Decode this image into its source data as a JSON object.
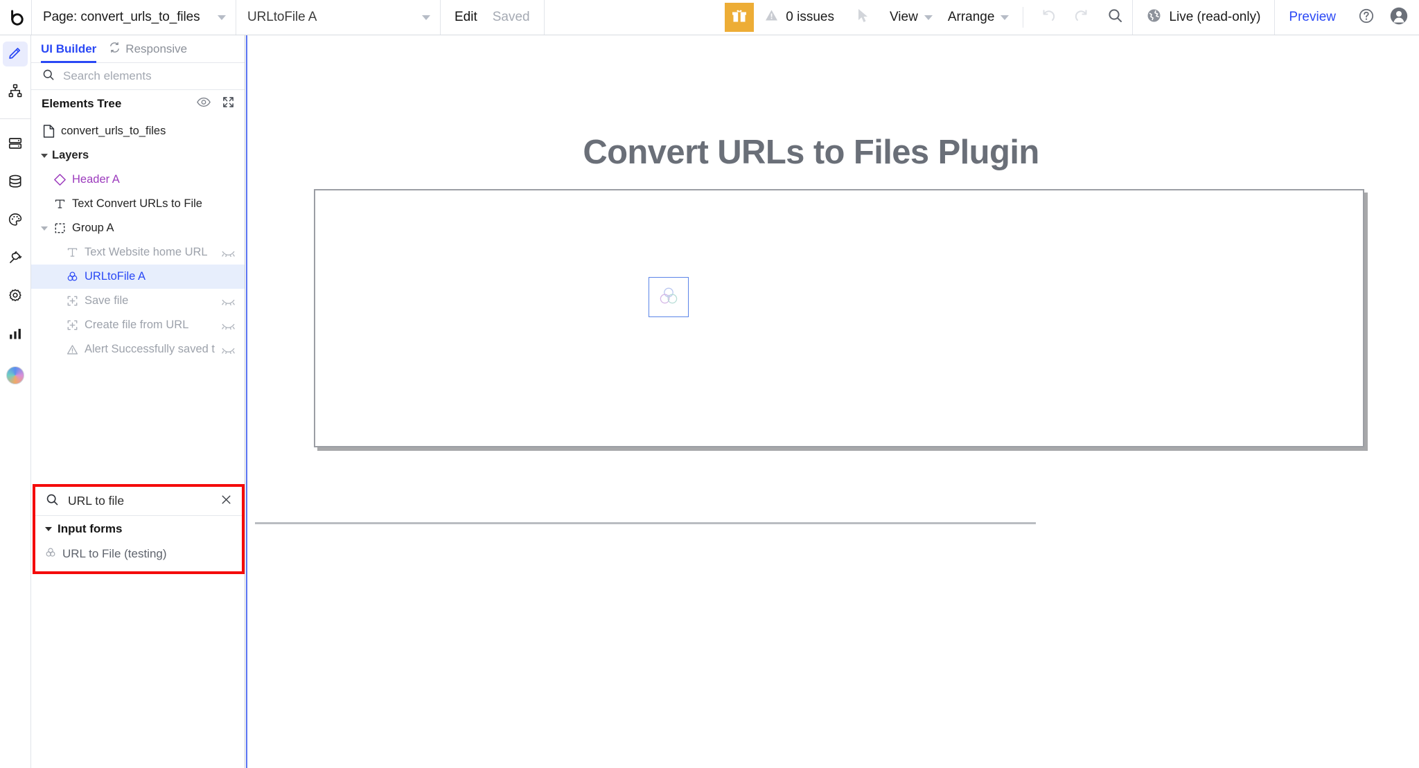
{
  "topbar": {
    "logo_icon": "bubble-logo-icon",
    "page_selector": {
      "label": "Page: convert_urls_to_files",
      "icon": "chevron-down-icon"
    },
    "element_selector": {
      "label": "URLtoFile A",
      "icon": "chevron-down-icon"
    },
    "edit_label": "Edit",
    "saved_label": "Saved",
    "gift_icon": "gift-icon",
    "issues": {
      "icon": "warning-triangle-icon",
      "label": "0 issues"
    },
    "cursor_icon": "cursor-arrow-icon",
    "view_menu": "View",
    "arrange_menu": "Arrange",
    "undo_icon": "undo-icon",
    "redo_icon": "redo-icon",
    "search_icon": "search-icon",
    "live": {
      "icon": "globe-icon",
      "label": "Live (read-only)"
    },
    "preview_label": "Preview",
    "help_icon": "question-circle-icon",
    "avatar_icon": "user-avatar-icon"
  },
  "rail": {
    "items": [
      {
        "name": "design",
        "icon": "pencil-icon",
        "active": true
      },
      {
        "name": "workflow",
        "icon": "sitemap-icon",
        "active": false
      },
      {
        "name": "data-sources",
        "icon": "server-icon",
        "active": false
      },
      {
        "name": "database",
        "icon": "database-icon",
        "active": false
      },
      {
        "name": "styles",
        "icon": "palette-icon",
        "active": false
      },
      {
        "name": "plugins",
        "icon": "plug-icon",
        "active": false
      },
      {
        "name": "settings",
        "icon": "gear-icon",
        "active": false
      },
      {
        "name": "logs",
        "icon": "bar-chart-icon",
        "active": false
      }
    ],
    "avatar_icon": "user-avatar-icon"
  },
  "panel": {
    "tabs": [
      {
        "label": "UI Builder",
        "active": true,
        "icon": ""
      },
      {
        "label": "Responsive",
        "active": false,
        "icon": "responsive-sync-icon"
      }
    ],
    "search": {
      "placeholder": "Search elements",
      "icon": "search-icon",
      "value": ""
    },
    "tree_header": {
      "title": "Elements Tree",
      "eye_icon": "eye-icon",
      "expand_icon": "expand-arrows-icon"
    },
    "tree": [
      {
        "label": "convert_urls_to_files",
        "icon": "page-file-icon",
        "indent": 0,
        "caret": "none",
        "color": "dark",
        "hidden": false,
        "selected": false
      },
      {
        "label": "Layers",
        "icon": "none",
        "indent": 1,
        "caret": "open",
        "color": "dark",
        "bold": true,
        "hidden": false,
        "selected": false
      },
      {
        "label": "Header A",
        "icon": "reusable-diamond-icon",
        "indent": 2,
        "caret": "none",
        "color": "purple",
        "hidden": false,
        "selected": false
      },
      {
        "label": "Text Convert URLs to File",
        "icon": "text-t-icon",
        "indent": 2,
        "caret": "none",
        "color": "dark",
        "hidden": false,
        "selected": false
      },
      {
        "label": "Group A",
        "icon": "group-dashed-icon",
        "indent": 1,
        "caret": "open-dim",
        "color": "dark",
        "hidden": false,
        "selected": false
      },
      {
        "label": "Text Website home URL",
        "icon": "text-t-icon",
        "indent": 3,
        "caret": "none",
        "color": "grey",
        "hidden": true,
        "selected": false
      },
      {
        "label": "URLtoFile A",
        "icon": "plugin-circles-icon",
        "indent": 3,
        "caret": "none",
        "color": "blue",
        "hidden": false,
        "selected": true
      },
      {
        "label": "Save file",
        "icon": "element-plus-icon",
        "indent": 3,
        "caret": "none",
        "color": "grey",
        "hidden": true,
        "selected": false
      },
      {
        "label": "Create file from URL",
        "icon": "element-plus-icon",
        "indent": 3,
        "caret": "none",
        "color": "grey",
        "hidden": true,
        "selected": false
      },
      {
        "label": "Alert Successfully saved t",
        "icon": "alert-triangle-icon",
        "indent": 3,
        "caret": "none",
        "color": "grey",
        "hidden": true,
        "selected": false
      }
    ],
    "popup": {
      "border_color": "#f40b0b",
      "search": {
        "value": "URL to file",
        "icon": "search-icon",
        "clear_icon": "close-x-icon"
      },
      "group_label": "Input forms",
      "result": {
        "label": "URL to File (testing)",
        "icon": "plugin-circles-icon"
      }
    }
  },
  "canvas": {
    "title": "Convert URLs to Files Plugin",
    "plugin_element_icon": "plugin-preview-icon"
  }
}
